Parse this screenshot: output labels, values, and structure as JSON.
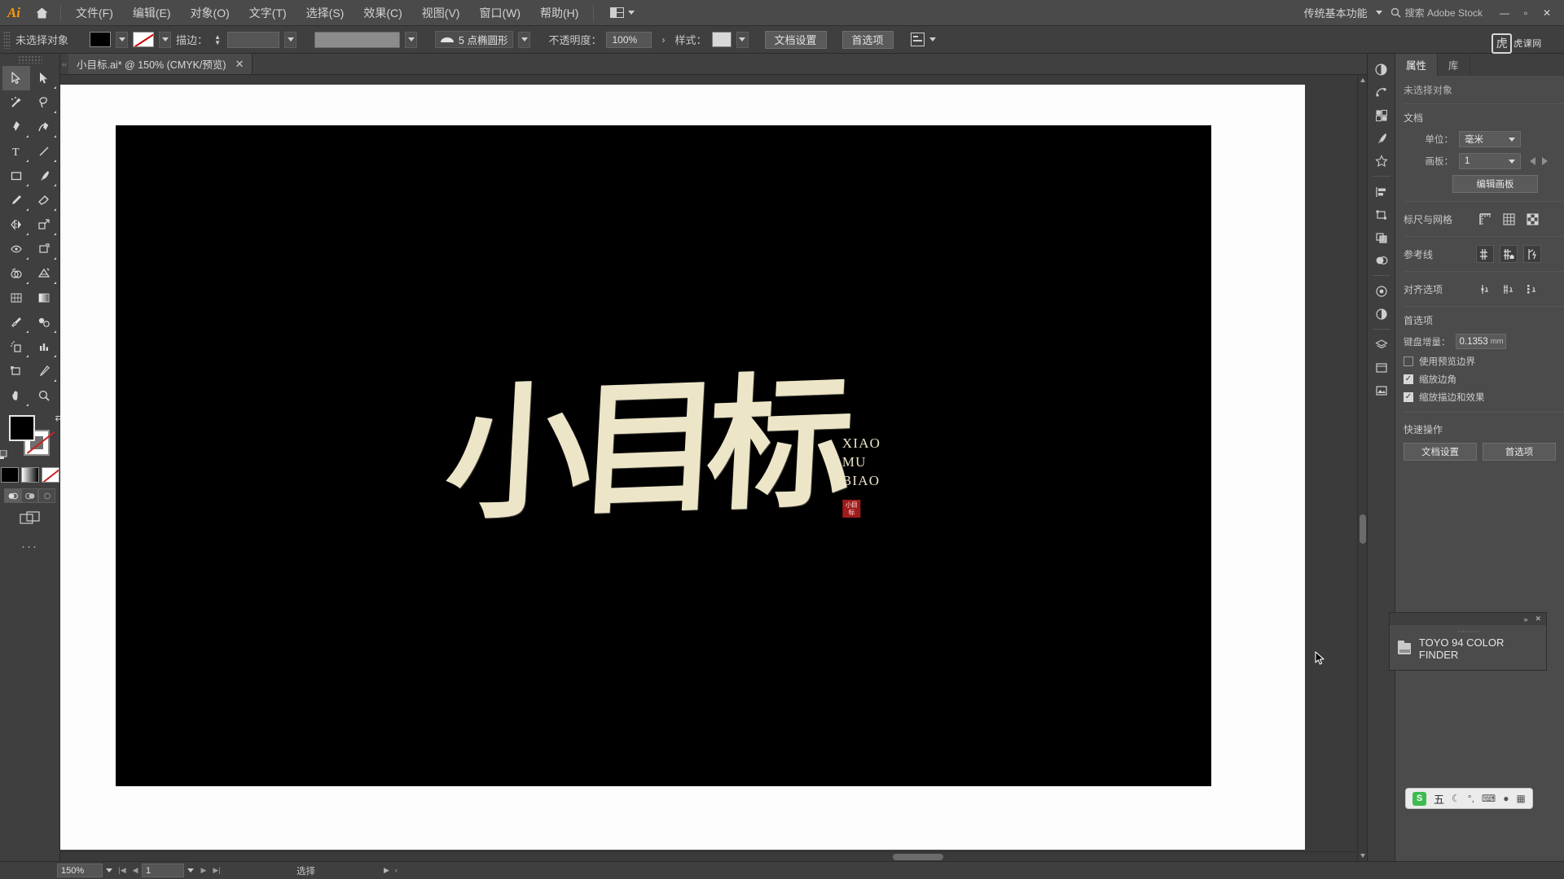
{
  "app": {
    "logo": "Ai",
    "home_icon": "home-icon",
    "workspace": "传统基本功能",
    "search_placeholder": "搜索 Adobe Stock",
    "arrange_icon": "arrange-documents-icon",
    "watermark": "虎课网"
  },
  "menu": {
    "items": [
      {
        "label": "文件(F)"
      },
      {
        "label": "编辑(E)"
      },
      {
        "label": "对象(O)"
      },
      {
        "label": "文字(T)"
      },
      {
        "label": "选择(S)"
      },
      {
        "label": "效果(C)"
      },
      {
        "label": "视图(V)"
      },
      {
        "label": "窗口(W)"
      },
      {
        "label": "帮助(H)"
      }
    ]
  },
  "window_controls": {
    "minimize": "—",
    "maximize": "▫",
    "close": "✕"
  },
  "control_bar": {
    "selection_status": "未选择对象",
    "fill_color": "#000000",
    "stroke_color": "none",
    "stroke_label": "描边：",
    "stroke_weight": "",
    "stroke_profile": "5 点椭圆形",
    "opacity_label": "不透明度：",
    "opacity_value": "100%",
    "style_label": "样式：",
    "doc_setup_button": "文档设置",
    "preferences_button": "首选项",
    "align_icon": "align-icon"
  },
  "toolbar": {
    "tools": [
      {
        "name": "selection-tool",
        "selected": true
      },
      {
        "name": "direct-selection-tool",
        "selected": false
      },
      {
        "name": "magic-wand-tool",
        "selected": false
      },
      {
        "name": "lasso-tool",
        "selected": false
      },
      {
        "name": "pen-tool",
        "selected": false
      },
      {
        "name": "curvature-tool",
        "selected": false
      },
      {
        "name": "type-tool",
        "selected": false
      },
      {
        "name": "line-segment-tool",
        "selected": false
      },
      {
        "name": "rectangle-tool",
        "selected": false
      },
      {
        "name": "paintbrush-tool",
        "selected": false
      },
      {
        "name": "pencil-tool",
        "selected": false
      },
      {
        "name": "eraser-tool",
        "selected": false
      },
      {
        "name": "rotate-tool",
        "selected": false
      },
      {
        "name": "scale-tool",
        "selected": false
      },
      {
        "name": "width-tool",
        "selected": false
      },
      {
        "name": "free-transform-tool",
        "selected": false
      },
      {
        "name": "shape-builder-tool",
        "selected": false
      },
      {
        "name": "perspective-grid-tool",
        "selected": false
      },
      {
        "name": "mesh-tool",
        "selected": false
      },
      {
        "name": "gradient-tool",
        "selected": false
      },
      {
        "name": "eyedropper-tool",
        "selected": false
      },
      {
        "name": "blend-tool",
        "selected": false
      },
      {
        "name": "symbol-sprayer-tool",
        "selected": false
      },
      {
        "name": "column-graph-tool",
        "selected": false
      },
      {
        "name": "artboard-tool",
        "selected": false
      },
      {
        "name": "slice-tool",
        "selected": false
      },
      {
        "name": "hand-tool",
        "selected": false
      },
      {
        "name": "zoom-tool",
        "selected": false
      }
    ],
    "fill_swatch": "#000000",
    "stroke_swatch": "none",
    "draw_modes": [
      "draw-normal",
      "draw-behind",
      "draw-inside"
    ],
    "screen_mode": "screen-mode-icon",
    "more_tools": "···"
  },
  "document": {
    "tab_title": "小目标.ai* @ 150% (CMYK/预览)",
    "close_icon": "✕",
    "artwork": {
      "characters": "小目标",
      "pinyin": [
        "XIAO",
        "MU",
        "BIAO"
      ],
      "seal_text": "小目标",
      "ink_color": "#ece5c8",
      "background_color": "#000000",
      "seal_color": "#a01b1b"
    }
  },
  "dock": {
    "icons": [
      {
        "name": "color-panel-icon"
      },
      {
        "name": "color-guide-icon"
      },
      {
        "name": "swatches-panel-icon"
      },
      {
        "name": "brushes-panel-icon"
      },
      {
        "name": "symbols-panel-icon"
      },
      {
        "name": "align-panel-icon"
      },
      {
        "name": "transform-panel-icon"
      },
      {
        "name": "pathfinder-panel-icon"
      },
      {
        "name": "transparency-panel-icon"
      },
      {
        "name": "appearance-panel-icon"
      },
      {
        "name": "graphic-styles-icon"
      },
      {
        "name": "layers-panel-icon"
      },
      {
        "name": "artboards-panel-icon"
      },
      {
        "name": "links-panel-icon"
      }
    ]
  },
  "properties": {
    "tabs": [
      {
        "label": "属性",
        "active": true
      },
      {
        "label": "库",
        "active": false
      }
    ],
    "selection_status": "未选择对象",
    "document_section": {
      "title": "文档",
      "unit_label": "单位：",
      "unit_value": "毫米",
      "artboard_label": "画板：",
      "artboard_value": "1",
      "edit_artboards_button": "编辑画板"
    },
    "rulers_grid": {
      "label": "标尺与网格",
      "icons": [
        "show-rulers-icon",
        "show-grid-icon",
        "show-transparency-grid-icon"
      ]
    },
    "guides": {
      "label": "参考线",
      "icons": [
        "show-guides-icon",
        "lock-guides-icon",
        "smart-guides-icon"
      ]
    },
    "snap_options": {
      "label": "对齐选项",
      "icons": [
        "snap-to-point-icon",
        "snap-to-grid-icon",
        "snap-to-pixel-icon"
      ]
    },
    "preferences": {
      "title": "首选项",
      "keyboard_increment_label": "键盘增量：",
      "keyboard_increment_value": "0.1353",
      "keyboard_increment_unit": "mm",
      "checkboxes": [
        {
          "label": "使用预览边界",
          "checked": false
        },
        {
          "label": "缩放边角",
          "checked": true
        },
        {
          "label": "缩放描边和效果",
          "checked": true
        }
      ]
    },
    "quick_actions": {
      "title": "快速操作",
      "buttons": [
        "文档设置",
        "首选项"
      ]
    }
  },
  "floating_panel": {
    "title": "",
    "collapse_icon": "»",
    "close_icon": "✕",
    "items": [
      {
        "label": "TOYO 94 COLOR FINDER",
        "icon": "folder-icon"
      }
    ]
  },
  "ime_bar": {
    "logo": "S",
    "mode": "五",
    "icons": [
      "moon-icon",
      "comma-icon",
      "keyboard-icon",
      "user-icon",
      "apps-icon"
    ]
  },
  "status_bar": {
    "zoom": "150%",
    "page": "1",
    "status_text": "选择"
  }
}
